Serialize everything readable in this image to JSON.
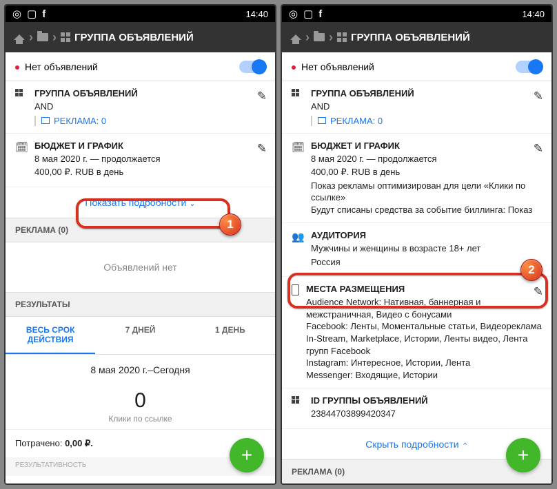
{
  "statusbar": {
    "time": "14:40"
  },
  "breadcrumb": {
    "title": "ГРУППА ОБЪЯВЛЕНИЙ"
  },
  "topbar": {
    "status": "Нет объявлений"
  },
  "adset_card": {
    "title": "ГРУППА ОБЪЯВЛЕНИЙ",
    "name": "AND",
    "ad_label": "РЕКЛАМА: 0"
  },
  "budget_card": {
    "title": "БЮДЖЕТ И ГРАФИК",
    "schedule": "8 мая 2020 г. — продолжается",
    "budget": "400,00 ₽. RUB в день",
    "optimization": "Показ рекламы оптимизирован для цели «Клики по ссылке»",
    "billing": "Будут списаны средства за событие биллинга: Показ"
  },
  "show_details": "Показать подробности",
  "hide_details": "Скрыть подробности",
  "audience_card": {
    "title": "АУДИТОРИЯ",
    "line1": "Мужчины и женщины в возрасте 18+ лет",
    "line2": "Россия"
  },
  "placements_card": {
    "title": "МЕСТА РАЗМЕЩЕНИЯ",
    "an": "Audience Network: Нативная, баннерная и межстраничная, Видео с бонусами",
    "fb": "Facebook: Ленты, Моментальные статьи, Видеореклама In-Stream, Marketplace, Истории, Ленты видео, Лента групп Facebook",
    "ig": "Instagram: Интересное, Истории, Лента",
    "msg": "Messenger: Входящие, Истории"
  },
  "id_card": {
    "title": "ID ГРУППЫ ОБЪЯВЛЕНИЙ",
    "value": "23844703899420347"
  },
  "ads_section": {
    "header": "РЕКЛАМА (0)",
    "empty": "Объявлений нет"
  },
  "results": {
    "header": "РЕЗУЛЬТАТЫ",
    "tabs": {
      "lifetime": "ВЕСЬ СРОК ДЕЙСТВИЯ",
      "d7": "7 ДНЕЙ",
      "d1": "1 ДЕНЬ"
    },
    "date_range": "8 мая 2020 г.–Сегодня",
    "value": "0",
    "metric": "Клики по ссылке",
    "spent_label": "Потрачено:",
    "spent_value": "0,00 ₽.",
    "performance_label": "РЕЗУЛЬТАТИВНОСТЬ"
  },
  "callouts": {
    "one": "1",
    "two": "2"
  }
}
